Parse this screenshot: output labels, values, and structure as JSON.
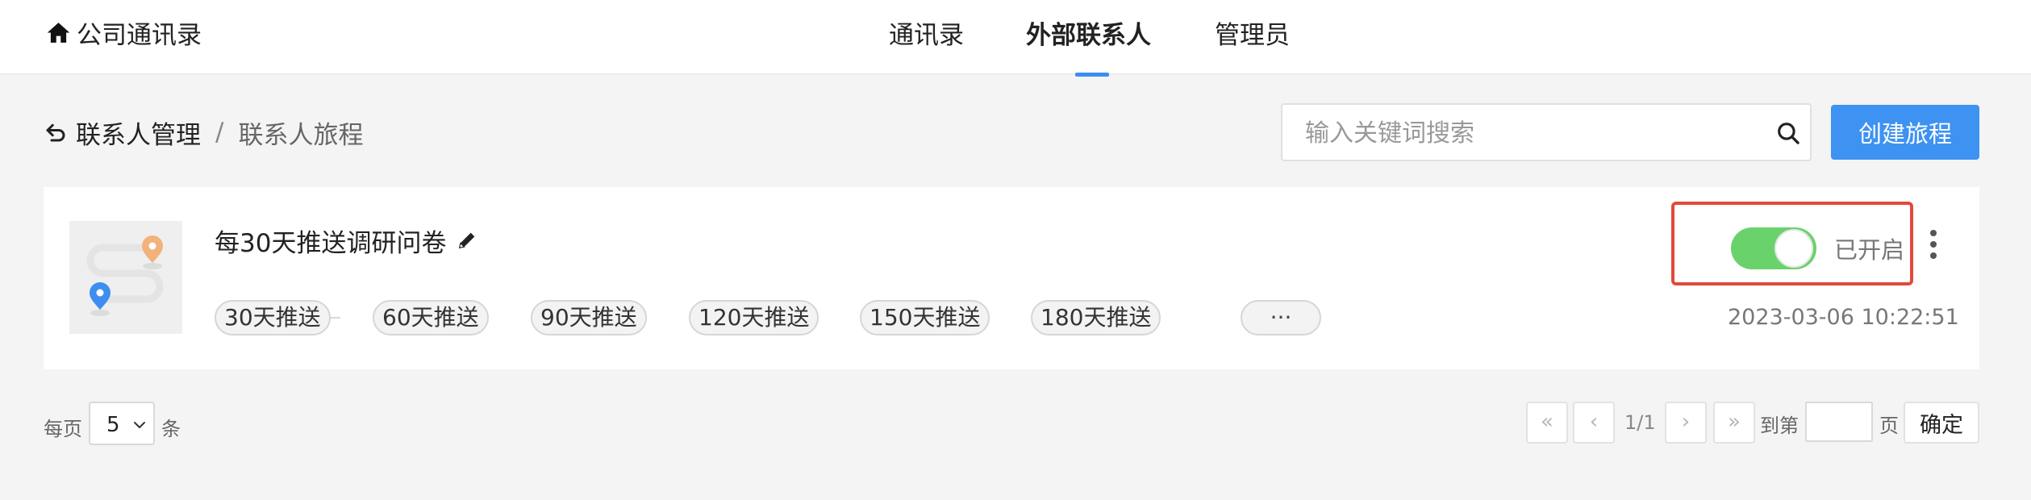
{
  "header": {
    "brand": "公司通讯录",
    "tabs": [
      {
        "label": "通讯录"
      },
      {
        "label": "外部联系人"
      },
      {
        "label": "管理员"
      }
    ],
    "active_tab": 1
  },
  "breadcrumb": {
    "parent": "联系人管理",
    "separator": "/",
    "current": "联系人旅程"
  },
  "search": {
    "placeholder": "输入关键词搜索",
    "value": ""
  },
  "create_button": "创建旅程",
  "journey": {
    "title": "每30天推送调研问卷",
    "steps": [
      "30天推送",
      "60天推送",
      "90天推送",
      "120天推送",
      "150天推送",
      "180天推送"
    ],
    "more_label": "···",
    "status_enabled": true,
    "status_label": "已开启",
    "updated_at": "2023-03-06 10:22:51"
  },
  "pagination": {
    "per_page_prefix": "每页",
    "per_page_value": "5",
    "per_page_suffix": "条",
    "first": "«",
    "prev": "‹",
    "page_info": "1/1",
    "next": "›",
    "last": "»",
    "goto_prefix": "到第",
    "goto_value": "",
    "goto_suffix": "页",
    "confirm": "确定"
  },
  "colors": {
    "primary": "#3d92f2",
    "toggle_on": "#6ad26b",
    "highlight": "#e24a3b",
    "pin_orange": "#f2b27a",
    "pin_blue": "#3d8ef0"
  }
}
